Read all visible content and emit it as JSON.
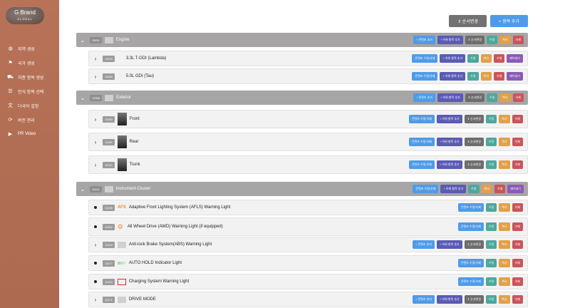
{
  "brand": {
    "line1": "G Brand",
    "line2": "GLOBAL"
  },
  "sidebar": {
    "items": [
      {
        "label": "지역 생성",
        "icon": "globe-icon"
      },
      {
        "label": "국가 생성",
        "icon": "flag-icon"
      },
      {
        "label": "차종 항목 생성",
        "icon": "car-icon"
      },
      {
        "label": "언식 항목 선택",
        "icon": "list-icon"
      },
      {
        "label": "다국어 설정",
        "icon": "translate-icon"
      },
      {
        "label": "버전 관리",
        "icon": "refresh-icon"
      },
      {
        "label": "PR Video",
        "icon": "video-icon"
      }
    ]
  },
  "toolbar": {
    "order_label": "⇕ 순서변경",
    "add_label": "+ 항목 추가"
  },
  "buttons": {
    "add_content": "+ 콘텐츠 추가",
    "add_sub": "+ 하위 항목 추가",
    "order": "⇕ 순서변경",
    "edit": "수정",
    "copy": "복사",
    "delete": "삭제",
    "content_edit": "콘텐츠 수정/삭제",
    "detach": "떼어내기"
  },
  "groups": [
    {
      "code": "11651",
      "label": "Engine"
    },
    {
      "code": "12068",
      "label": "Exterior"
    },
    {
      "code": "11141",
      "label": "Instrument Cluster"
    }
  ],
  "rows": [
    {
      "code": "11092",
      "label": "3.3L T-GDI (Lambda)"
    },
    {
      "code": "11060",
      "label": "5.0L GDI (Tau)"
    },
    {
      "code": "11080",
      "label": "Front"
    },
    {
      "code": "11109",
      "label": "Rear"
    },
    {
      "code": "11120",
      "label": "Trunk"
    },
    {
      "code": "11466",
      "label": "Adaptive Front Lighting System (AFLS) Warning Light",
      "badge": "AFS"
    },
    {
      "code": "11462",
      "label": "All Wheel Drive (AWD) Warning Light (if equipped)"
    },
    {
      "code": "11449",
      "label": "Anti-lock Brake System(ABS) Warning Light"
    },
    {
      "code": "11477",
      "label": "AUTO HOLD Indicator Light"
    },
    {
      "code": "11454",
      "label": "Charging System Warning Light"
    },
    {
      "code": "11471",
      "label": "DRIVE MODE"
    }
  ],
  "colors": {
    "sidebar": "#b77257",
    "header": "#a7a5a5",
    "primary": "#4f9be8"
  }
}
